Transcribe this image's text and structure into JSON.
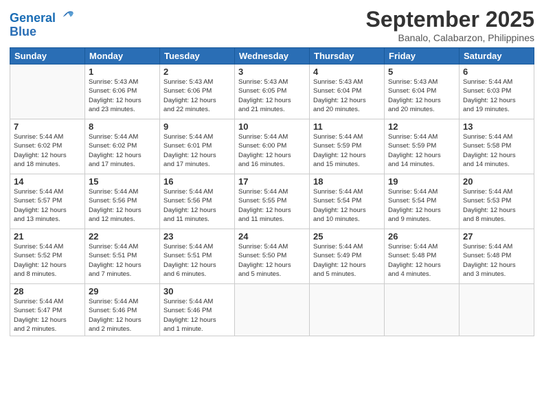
{
  "logo": {
    "line1": "General",
    "line2": "Blue"
  },
  "title": "September 2025",
  "subtitle": "Banalo, Calabarzon, Philippines",
  "days_of_week": [
    "Sunday",
    "Monday",
    "Tuesday",
    "Wednesday",
    "Thursday",
    "Friday",
    "Saturday"
  ],
  "weeks": [
    [
      {
        "day": "",
        "info": ""
      },
      {
        "day": "1",
        "info": "Sunrise: 5:43 AM\nSunset: 6:06 PM\nDaylight: 12 hours\nand 23 minutes."
      },
      {
        "day": "2",
        "info": "Sunrise: 5:43 AM\nSunset: 6:06 PM\nDaylight: 12 hours\nand 22 minutes."
      },
      {
        "day": "3",
        "info": "Sunrise: 5:43 AM\nSunset: 6:05 PM\nDaylight: 12 hours\nand 21 minutes."
      },
      {
        "day": "4",
        "info": "Sunrise: 5:43 AM\nSunset: 6:04 PM\nDaylight: 12 hours\nand 20 minutes."
      },
      {
        "day": "5",
        "info": "Sunrise: 5:43 AM\nSunset: 6:04 PM\nDaylight: 12 hours\nand 20 minutes."
      },
      {
        "day": "6",
        "info": "Sunrise: 5:44 AM\nSunset: 6:03 PM\nDaylight: 12 hours\nand 19 minutes."
      }
    ],
    [
      {
        "day": "7",
        "info": "Sunrise: 5:44 AM\nSunset: 6:02 PM\nDaylight: 12 hours\nand 18 minutes."
      },
      {
        "day": "8",
        "info": "Sunrise: 5:44 AM\nSunset: 6:02 PM\nDaylight: 12 hours\nand 17 minutes."
      },
      {
        "day": "9",
        "info": "Sunrise: 5:44 AM\nSunset: 6:01 PM\nDaylight: 12 hours\nand 17 minutes."
      },
      {
        "day": "10",
        "info": "Sunrise: 5:44 AM\nSunset: 6:00 PM\nDaylight: 12 hours\nand 16 minutes."
      },
      {
        "day": "11",
        "info": "Sunrise: 5:44 AM\nSunset: 5:59 PM\nDaylight: 12 hours\nand 15 minutes."
      },
      {
        "day": "12",
        "info": "Sunrise: 5:44 AM\nSunset: 5:59 PM\nDaylight: 12 hours\nand 14 minutes."
      },
      {
        "day": "13",
        "info": "Sunrise: 5:44 AM\nSunset: 5:58 PM\nDaylight: 12 hours\nand 14 minutes."
      }
    ],
    [
      {
        "day": "14",
        "info": "Sunrise: 5:44 AM\nSunset: 5:57 PM\nDaylight: 12 hours\nand 13 minutes."
      },
      {
        "day": "15",
        "info": "Sunrise: 5:44 AM\nSunset: 5:56 PM\nDaylight: 12 hours\nand 12 minutes."
      },
      {
        "day": "16",
        "info": "Sunrise: 5:44 AM\nSunset: 5:56 PM\nDaylight: 12 hours\nand 11 minutes."
      },
      {
        "day": "17",
        "info": "Sunrise: 5:44 AM\nSunset: 5:55 PM\nDaylight: 12 hours\nand 11 minutes."
      },
      {
        "day": "18",
        "info": "Sunrise: 5:44 AM\nSunset: 5:54 PM\nDaylight: 12 hours\nand 10 minutes."
      },
      {
        "day": "19",
        "info": "Sunrise: 5:44 AM\nSunset: 5:54 PM\nDaylight: 12 hours\nand 9 minutes."
      },
      {
        "day": "20",
        "info": "Sunrise: 5:44 AM\nSunset: 5:53 PM\nDaylight: 12 hours\nand 8 minutes."
      }
    ],
    [
      {
        "day": "21",
        "info": "Sunrise: 5:44 AM\nSunset: 5:52 PM\nDaylight: 12 hours\nand 8 minutes."
      },
      {
        "day": "22",
        "info": "Sunrise: 5:44 AM\nSunset: 5:51 PM\nDaylight: 12 hours\nand 7 minutes."
      },
      {
        "day": "23",
        "info": "Sunrise: 5:44 AM\nSunset: 5:51 PM\nDaylight: 12 hours\nand 6 minutes."
      },
      {
        "day": "24",
        "info": "Sunrise: 5:44 AM\nSunset: 5:50 PM\nDaylight: 12 hours\nand 5 minutes."
      },
      {
        "day": "25",
        "info": "Sunrise: 5:44 AM\nSunset: 5:49 PM\nDaylight: 12 hours\nand 5 minutes."
      },
      {
        "day": "26",
        "info": "Sunrise: 5:44 AM\nSunset: 5:48 PM\nDaylight: 12 hours\nand 4 minutes."
      },
      {
        "day": "27",
        "info": "Sunrise: 5:44 AM\nSunset: 5:48 PM\nDaylight: 12 hours\nand 3 minutes."
      }
    ],
    [
      {
        "day": "28",
        "info": "Sunrise: 5:44 AM\nSunset: 5:47 PM\nDaylight: 12 hours\nand 2 minutes."
      },
      {
        "day": "29",
        "info": "Sunrise: 5:44 AM\nSunset: 5:46 PM\nDaylight: 12 hours\nand 2 minutes."
      },
      {
        "day": "30",
        "info": "Sunrise: 5:44 AM\nSunset: 5:46 PM\nDaylight: 12 hours\nand 1 minute."
      },
      {
        "day": "",
        "info": ""
      },
      {
        "day": "",
        "info": ""
      },
      {
        "day": "",
        "info": ""
      },
      {
        "day": "",
        "info": ""
      }
    ]
  ]
}
